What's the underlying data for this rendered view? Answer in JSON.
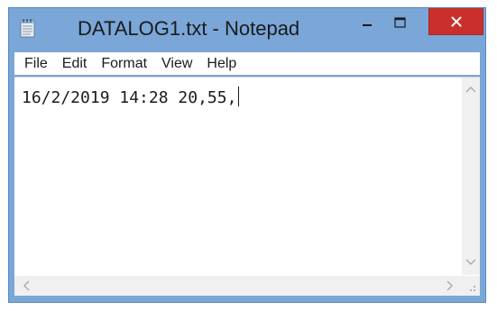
{
  "window": {
    "title": "DATALOG1.txt - Notepad"
  },
  "menu": {
    "items": [
      "File",
      "Edit",
      "Format",
      "View",
      "Help"
    ]
  },
  "editor": {
    "content": "16/2/2019 14:28 20,55,"
  },
  "icons": {
    "app": "notepad-icon",
    "minimize": "minimize-icon",
    "maximize": "maximize-icon",
    "close": "close-icon",
    "scroll_up": "chevron-up-icon",
    "scroll_down": "chevron-down-icon",
    "scroll_left": "chevron-left-icon",
    "scroll_right": "chevron-right-icon",
    "resize_grip": "resize-grip-icon"
  },
  "colors": {
    "frame": "#7aa6d8",
    "close_button": "#c9302c"
  }
}
